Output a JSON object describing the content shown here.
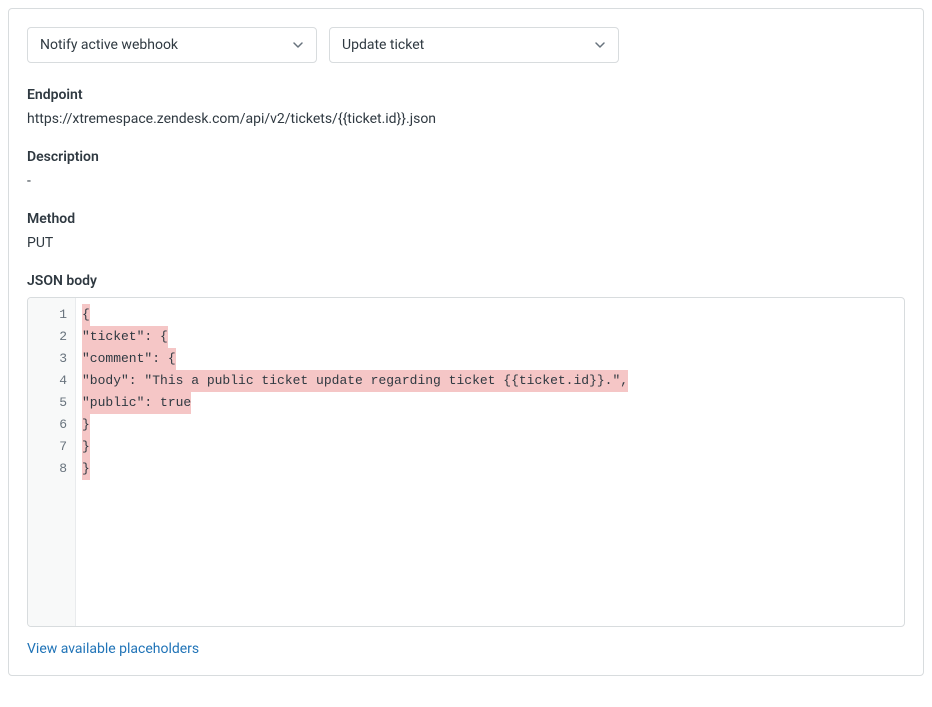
{
  "selects": {
    "action": "Notify active webhook",
    "target": "Update ticket"
  },
  "endpoint": {
    "label": "Endpoint",
    "value": "https://xtremespace.zendesk.com/api/v2/tickets/{{ticket.id}}.json"
  },
  "description": {
    "label": "Description",
    "value": "-"
  },
  "method": {
    "label": "Method",
    "value": "PUT"
  },
  "json_body": {
    "label": "JSON body",
    "lines": [
      "{",
      "\"ticket\": {",
      "\"comment\": {",
      "\"body\": \"This a public ticket update regarding ticket {{ticket.id}}.\",",
      "\"public\": true",
      "}",
      "}",
      "}"
    ]
  },
  "link": {
    "placeholders": "View available placeholders"
  }
}
